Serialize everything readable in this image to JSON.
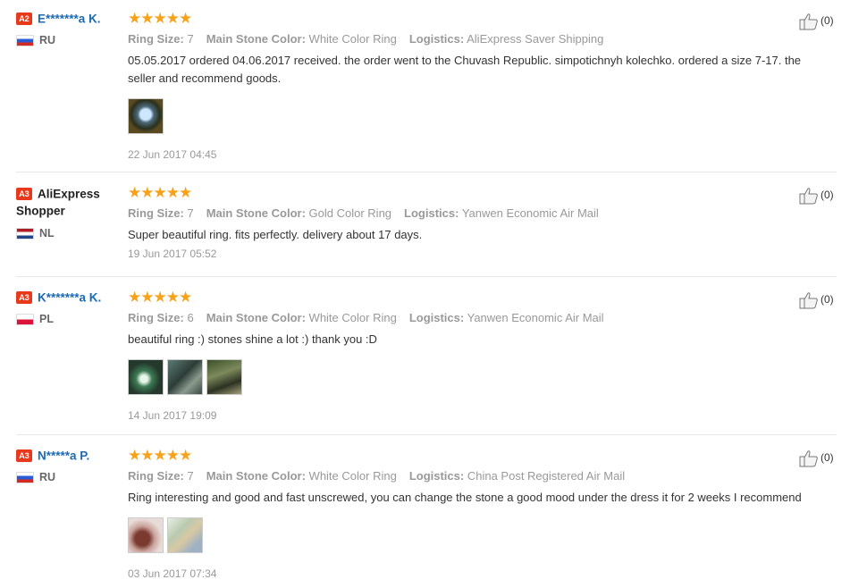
{
  "reviews": [
    {
      "badge": "A2",
      "name": "E*******a K.",
      "country": "RU",
      "flag": "ru",
      "stars": "★★★★★",
      "ring_size_label": "Ring Size:",
      "ring_size": "7",
      "stone_label": "Main Stone Color:",
      "stone": "White Color Ring",
      "logistics_label": "Logistics:",
      "logistics": "AliExpress Saver Shipping",
      "text": "05.05.2017 ordered 04.06.2017 received. the order went to the Chuvash Republic. simpotichnyh kolechko. ordered a size 7-17. the seller and recommend goods.",
      "photos": 1,
      "date": "22 Jun 2017 04:45",
      "likes": "(0)"
    },
    {
      "badge": "A3",
      "name": "AliExpress Shopper",
      "country": "NL",
      "flag": "nl",
      "stars": "★★★★★",
      "ring_size_label": "Ring Size:",
      "ring_size": "7",
      "stone_label": "Main Stone Color:",
      "stone": "Gold Color Ring",
      "logistics_label": "Logistics:",
      "logistics": "Yanwen Economic Air Mail",
      "text": "Super beautiful ring. fits perfectly. delivery about 17 days.",
      "photos": 0,
      "date": "19 Jun 2017 05:52",
      "likes": "(0)"
    },
    {
      "badge": "A3",
      "name": "K*******a K.",
      "country": "PL",
      "flag": "pl",
      "stars": "★★★★★",
      "ring_size_label": "Ring Size:",
      "ring_size": "6",
      "stone_label": "Main Stone Color:",
      "stone": "White Color Ring",
      "logistics_label": "Logistics:",
      "logistics": "Yanwen Economic Air Mail",
      "text": "beautiful ring :) stones shine a lot :) thank you :D",
      "photos": 3,
      "date": "14 Jun 2017 19:09",
      "likes": "(0)"
    },
    {
      "badge": "A3",
      "name": "N*****a P.",
      "country": "RU",
      "flag": "ru",
      "stars": "★★★★★",
      "ring_size_label": "Ring Size:",
      "ring_size": "7",
      "stone_label": "Main Stone Color:",
      "stone": "White Color Ring",
      "logistics_label": "Logistics:",
      "logistics": "China Post Registered Air Mail",
      "text": "Ring interesting and good and fast unscrewed, you can change the stone a good mood under the dress it for 2 weeks I recommend",
      "photos": 2,
      "date": "03 Jun 2017 07:34",
      "likes": "(0)"
    }
  ]
}
